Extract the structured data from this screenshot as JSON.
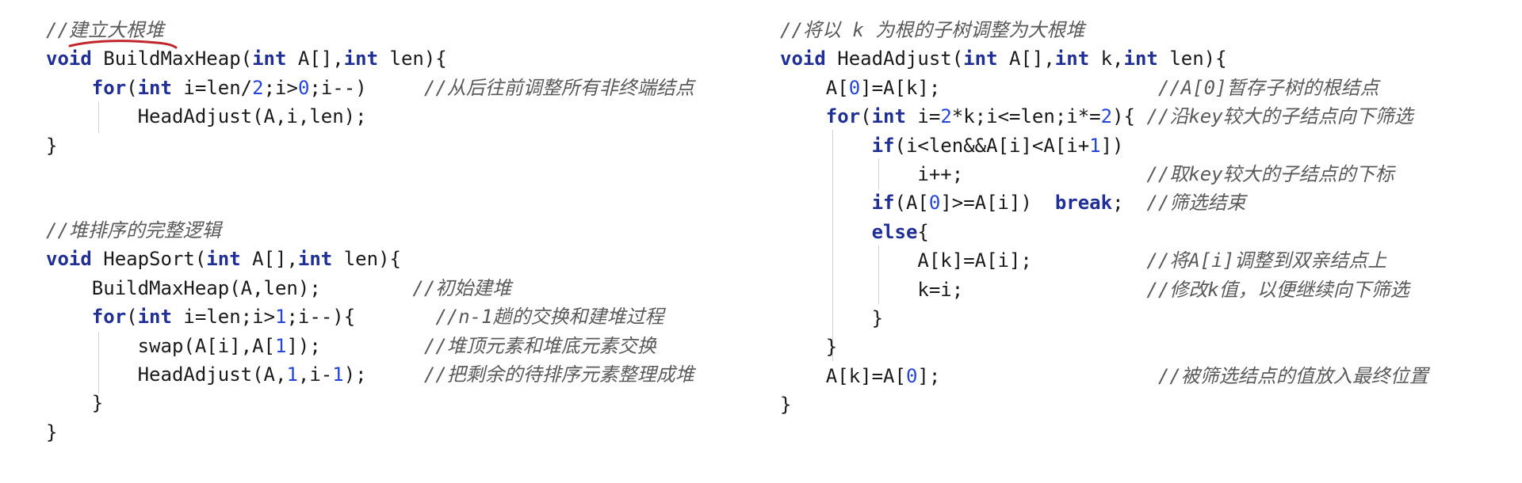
{
  "left_block": [
    [
      {
        "k": "cm",
        "t": "//建立大根堆"
      }
    ],
    [
      {
        "k": "kw",
        "t": "void"
      },
      {
        "k": "tx",
        "t": " BuildMaxHeap("
      },
      {
        "k": "kw",
        "t": "int"
      },
      {
        "k": "tx",
        "t": " A[],"
      },
      {
        "k": "kw",
        "t": "int"
      },
      {
        "k": "tx",
        "t": " len){"
      }
    ],
    [
      {
        "k": "tx",
        "t": "    "
      },
      {
        "k": "kw",
        "t": "for"
      },
      {
        "k": "tx",
        "t": "("
      },
      {
        "k": "kw",
        "t": "int"
      },
      {
        "k": "tx",
        "t": " i=len/"
      },
      {
        "k": "num",
        "t": "2"
      },
      {
        "k": "tx",
        "t": ";i>"
      },
      {
        "k": "num",
        "t": "0"
      },
      {
        "k": "tx",
        "t": ";i--)     "
      },
      {
        "k": "cm",
        "t": "//从后往前调整所有非终端结点"
      }
    ],
    [
      {
        "k": "tx",
        "t": "        HeadAdjust(A,i,len);"
      }
    ],
    [
      {
        "k": "tx",
        "t": "}"
      }
    ]
  ],
  "left_block2": [
    [
      {
        "k": "cm",
        "t": "//堆排序的完整逻辑"
      }
    ],
    [
      {
        "k": "kw",
        "t": "void"
      },
      {
        "k": "tx",
        "t": " HeapSort("
      },
      {
        "k": "kw",
        "t": "int"
      },
      {
        "k": "tx",
        "t": " A[],"
      },
      {
        "k": "kw",
        "t": "int"
      },
      {
        "k": "tx",
        "t": " len){"
      }
    ],
    [
      {
        "k": "tx",
        "t": "    BuildMaxHeap(A,len);        "
      },
      {
        "k": "cm",
        "t": "//初始建堆"
      }
    ],
    [
      {
        "k": "tx",
        "t": "    "
      },
      {
        "k": "kw",
        "t": "for"
      },
      {
        "k": "tx",
        "t": "("
      },
      {
        "k": "kw",
        "t": "int"
      },
      {
        "k": "tx",
        "t": " i=len;i>"
      },
      {
        "k": "num",
        "t": "1"
      },
      {
        "k": "tx",
        "t": ";i--){       "
      },
      {
        "k": "cm",
        "t": "//n-1趟的交换和建堆过程"
      }
    ],
    [
      {
        "k": "tx",
        "t": "        swap(A[i],A["
      },
      {
        "k": "num",
        "t": "1"
      },
      {
        "k": "tx",
        "t": "]);         "
      },
      {
        "k": "cm",
        "t": "//堆顶元素和堆底元素交换"
      }
    ],
    [
      {
        "k": "tx",
        "t": "        HeadAdjust(A,"
      },
      {
        "k": "num",
        "t": "1"
      },
      {
        "k": "tx",
        "t": ",i-"
      },
      {
        "k": "num",
        "t": "1"
      },
      {
        "k": "tx",
        "t": ");     "
      },
      {
        "k": "cm",
        "t": "//把剩余的待排序元素整理成堆"
      }
    ],
    [
      {
        "k": "tx",
        "t": "    }"
      }
    ],
    [
      {
        "k": "tx",
        "t": "}"
      }
    ]
  ],
  "right_block": [
    [
      {
        "k": "cm",
        "t": "//将以 k 为根的子树调整为大根堆"
      }
    ],
    [
      {
        "k": "kw",
        "t": "void"
      },
      {
        "k": "tx",
        "t": " HeadAdjust("
      },
      {
        "k": "kw",
        "t": "int"
      },
      {
        "k": "tx",
        "t": " A[],"
      },
      {
        "k": "kw",
        "t": "int"
      },
      {
        "k": "tx",
        "t": " k,"
      },
      {
        "k": "kw",
        "t": "int"
      },
      {
        "k": "tx",
        "t": " len){"
      }
    ],
    [
      {
        "k": "tx",
        "t": "    A["
      },
      {
        "k": "num",
        "t": "0"
      },
      {
        "k": "tx",
        "t": "]=A[k];                   "
      },
      {
        "k": "cm",
        "t": "//A[0]暂存子树的根结点"
      }
    ],
    [
      {
        "k": "tx",
        "t": "    "
      },
      {
        "k": "kw",
        "t": "for"
      },
      {
        "k": "tx",
        "t": "("
      },
      {
        "k": "kw",
        "t": "int"
      },
      {
        "k": "tx",
        "t": " i="
      },
      {
        "k": "num",
        "t": "2"
      },
      {
        "k": "tx",
        "t": "*k;i<=len;i*="
      },
      {
        "k": "num",
        "t": "2"
      },
      {
        "k": "tx",
        "t": "){ "
      },
      {
        "k": "cm",
        "t": "//沿key较大的子结点向下筛选"
      }
    ],
    [
      {
        "k": "tx",
        "t": "        "
      },
      {
        "k": "kw",
        "t": "if"
      },
      {
        "k": "tx",
        "t": "(i<len&&A[i]<A[i+"
      },
      {
        "k": "num",
        "t": "1"
      },
      {
        "k": "tx",
        "t": "])"
      }
    ],
    [
      {
        "k": "tx",
        "t": "            i++;                "
      },
      {
        "k": "cm",
        "t": "//取key较大的子结点的下标"
      }
    ],
    [
      {
        "k": "tx",
        "t": "        "
      },
      {
        "k": "kw",
        "t": "if"
      },
      {
        "k": "tx",
        "t": "(A["
      },
      {
        "k": "num",
        "t": "0"
      },
      {
        "k": "tx",
        "t": "]>=A[i])  "
      },
      {
        "k": "kw",
        "t": "break"
      },
      {
        "k": "tx",
        "t": ";  "
      },
      {
        "k": "cm",
        "t": "//筛选结束"
      }
    ],
    [
      {
        "k": "tx",
        "t": "        "
      },
      {
        "k": "kw",
        "t": "else"
      },
      {
        "k": "tx",
        "t": "{"
      }
    ],
    [
      {
        "k": "tx",
        "t": "            A[k]=A[i];          "
      },
      {
        "k": "cm",
        "t": "//将A[i]调整到双亲结点上"
      }
    ],
    [
      {
        "k": "tx",
        "t": "            k=i;                "
      },
      {
        "k": "cm",
        "t": "//修改k值，以便继续向下筛选"
      }
    ],
    [
      {
        "k": "tx",
        "t": "        }"
      }
    ],
    [
      {
        "k": "tx",
        "t": "    }"
      }
    ],
    [
      {
        "k": "tx",
        "t": "    A[k]=A["
      },
      {
        "k": "num",
        "t": "0"
      },
      {
        "k": "tx",
        "t": "];                   "
      },
      {
        "k": "cm",
        "t": "//被筛选结点的值放入最终位置"
      }
    ],
    [
      {
        "k": "tx",
        "t": "}"
      }
    ]
  ],
  "colors": {
    "keyword": "#1f2f96",
    "number": "#2546d8",
    "comment": "#5a5a5a",
    "annotation_underline": "#c0262b"
  }
}
